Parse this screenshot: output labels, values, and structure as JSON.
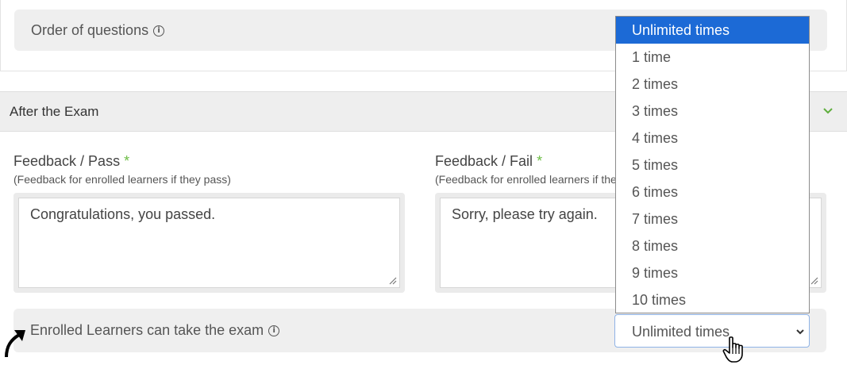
{
  "order_of_questions": {
    "label": "Order of questions",
    "icon": "info-icon"
  },
  "after_exam": {
    "title": "After the Exam",
    "icon": "chevron-down-icon",
    "accent": "#5fae3d"
  },
  "feedback_pass": {
    "label": "Feedback / Pass",
    "required_mark": "*",
    "help": "(Feedback for enrolled learners if they pass)",
    "value": "Congratulations, you passed."
  },
  "feedback_fail": {
    "label": "Feedback / Fail",
    "required_mark": "*",
    "help": "(Feedback for enrolled learners if they fail)",
    "value": "Sorry, please try again."
  },
  "enrolled": {
    "label": "Enrolled Learners can take the exam",
    "icon": "info-icon",
    "select_value": "Unlimited times"
  },
  "dropdown": {
    "selected_color": "#1c6ad6",
    "options": [
      "Unlimited times",
      "1 time",
      "2 times",
      "3 times",
      "4 times",
      "5 times",
      "6 times",
      "7 times",
      "8 times",
      "9 times",
      "10 times"
    ]
  }
}
